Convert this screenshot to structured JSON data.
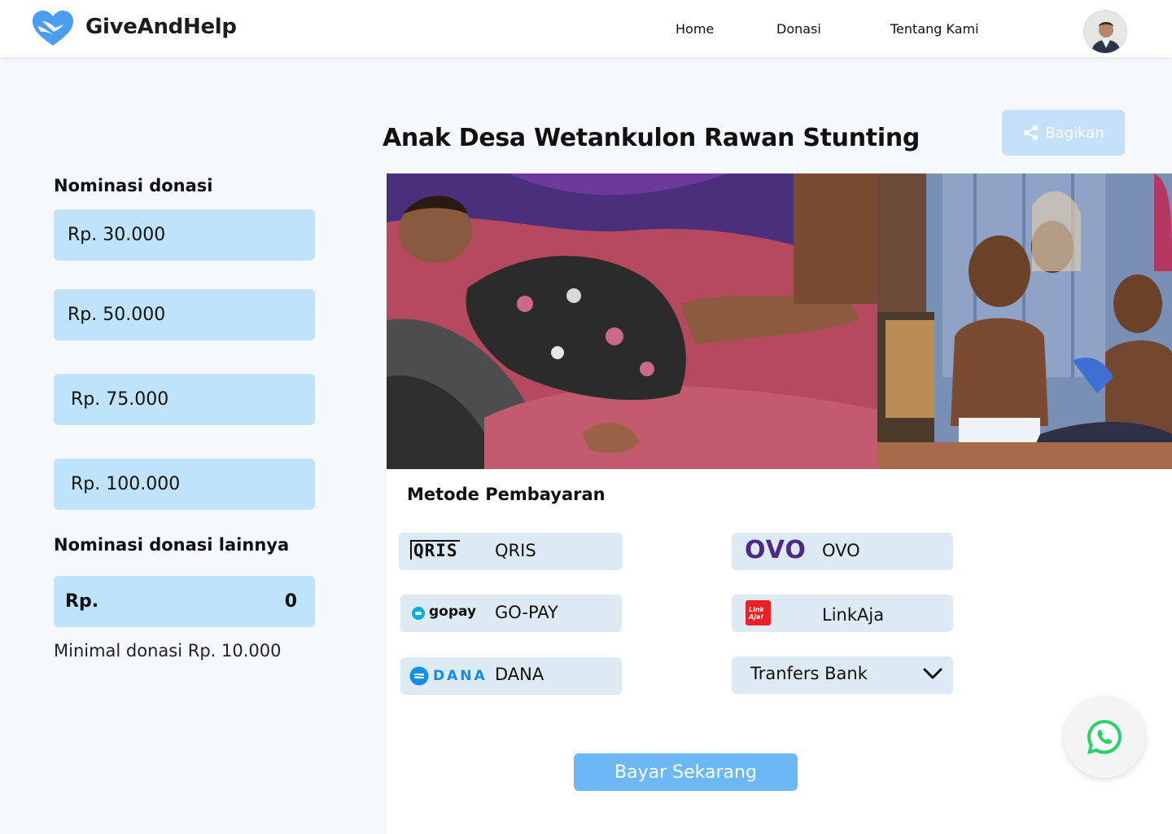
{
  "header": {
    "brand": "GiveAndHelp",
    "nav": [
      "Home",
      "Donasi",
      "Tentang Kami"
    ]
  },
  "left": {
    "nominal_label": "Nominasi donasi",
    "amounts": [
      "Rp. 30.000",
      "Rp. 50.000",
      "Rp. 75.000",
      "Rp. 100.000"
    ],
    "other_label": "Nominasi donasi lainnya",
    "custom_prefix": "Rp.",
    "custom_value": "0",
    "min_note": "Minimal donasi Rp. 10.000"
  },
  "campaign": {
    "title": "Anak Desa Wetankulon Rawan Stunting",
    "share_label": "Bagikan"
  },
  "payment": {
    "label": "Metode Pembayaran",
    "methods": [
      {
        "name": "QRIS",
        "logo_text": "QRIS"
      },
      {
        "name": "OVO",
        "logo_text": "OVO"
      },
      {
        "name": "GO-PAY",
        "logo_text": "gopay"
      },
      {
        "name": "LinkAja",
        "logo_text": "Link Aja!"
      },
      {
        "name": "DANA",
        "logo_text": "DANA"
      },
      {
        "name": "Tranfers Bank"
      }
    ],
    "submit_label": "Bayar Sekarang"
  },
  "colors": {
    "accent": "#6cb8f6",
    "amount_bg": "#bfe3fb",
    "method_bg": "#dde9f3",
    "page_bg": "#f5f9fe",
    "ovo_purple": "#4c2a86",
    "linkaja_red": "#e82127",
    "whatsapp_green": "#25d366"
  },
  "icons": [
    "heart-hands-logo-icon",
    "share-icon",
    "chevron-down-icon",
    "whatsapp-icon"
  ]
}
